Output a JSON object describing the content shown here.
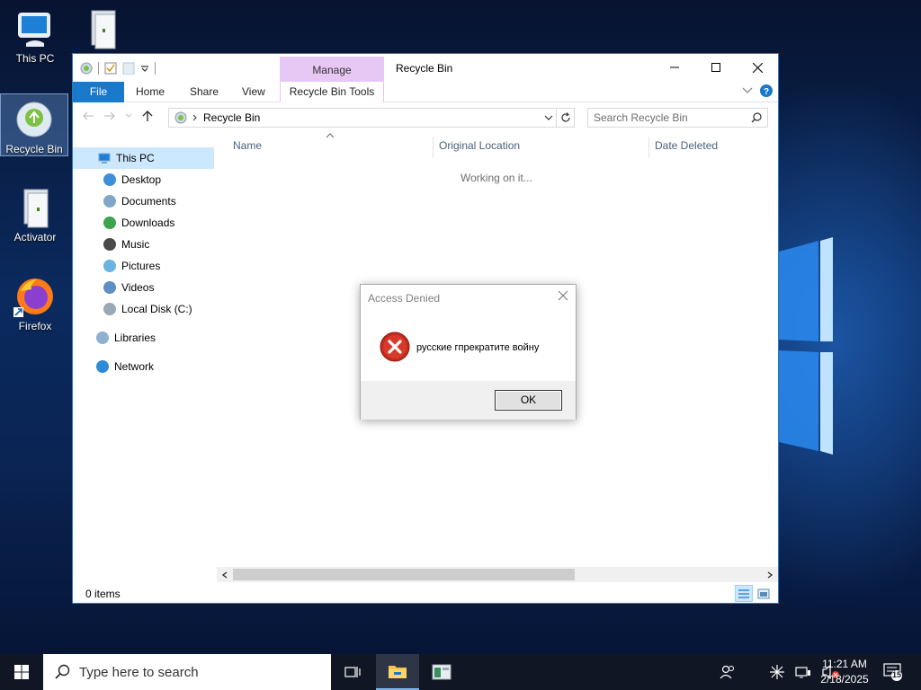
{
  "desktop": {
    "icons": [
      {
        "label": "This PC"
      },
      {
        "label": ""
      },
      {
        "label": "Recycle Bin"
      },
      {
        "label": "Activator"
      },
      {
        "label": "Firefox"
      }
    ]
  },
  "explorer": {
    "title": "Recycle Bin",
    "contextual_group": "Manage",
    "ribbon": {
      "tabs": [
        "File",
        "Home",
        "Share",
        "View",
        "Recycle Bin Tools"
      ]
    },
    "address": {
      "path": "Recycle Bin"
    },
    "search": {
      "placeholder": "Search Recycle Bin"
    },
    "nav": {
      "items": [
        {
          "label": "This PC"
        },
        {
          "label": "Desktop"
        },
        {
          "label": "Documents"
        },
        {
          "label": "Downloads"
        },
        {
          "label": "Music"
        },
        {
          "label": "Pictures"
        },
        {
          "label": "Videos"
        },
        {
          "label": "Local Disk (C:)"
        },
        {
          "label": "Libraries"
        },
        {
          "label": "Network"
        }
      ]
    },
    "columns": [
      "Name",
      "Original Location",
      "Date Deleted"
    ],
    "working_text": "Working on it...",
    "status": "0 items"
  },
  "dialog": {
    "title": "Access Denied",
    "message": "русские гпрекратите войну",
    "ok_label": "OK"
  },
  "taskbar": {
    "search_placeholder": "Type here to search",
    "time": "11:21 AM",
    "date": "2/18/2025",
    "notification_count": "15"
  },
  "colors": {
    "accent": "#1979ca",
    "manage_tab": "#e7c8f5",
    "selection": "#cce8ff",
    "taskbar": "#101624",
    "error_red": "#c42b1c"
  }
}
